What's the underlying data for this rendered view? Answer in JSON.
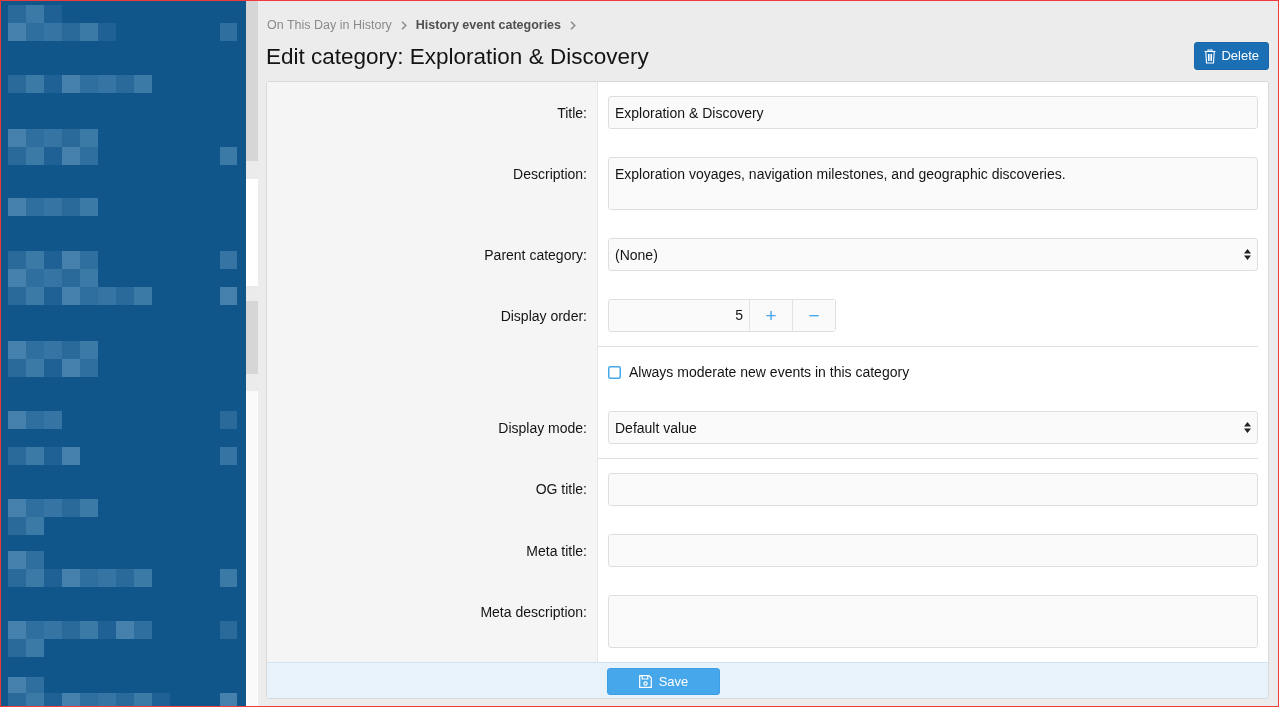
{
  "breadcrumb": [
    {
      "label": "On This Day in History",
      "current": false
    },
    {
      "label": "History event categories",
      "current": true
    }
  ],
  "title": "Edit category: Exploration & Discovery",
  "delete_button": {
    "label": "Delete"
  },
  "form": {
    "fields": [
      {
        "kind": "text",
        "label": "Title:",
        "value": "Exploration & Discovery",
        "separated": false
      },
      {
        "kind": "textarea",
        "label": "Description:",
        "value": "Exploration voyages, navigation milestones, and geographic discoveries.",
        "separated": false
      },
      {
        "kind": "select",
        "label": "Parent category:",
        "value": "(None)",
        "separated": false
      },
      {
        "kind": "number",
        "label": "Display order:",
        "value": "5",
        "buttons": [
          "+",
          "−"
        ],
        "separated": false
      },
      {
        "kind": "checkbox",
        "label": "Always moderate new events in this category",
        "checked": false,
        "separated": true
      },
      {
        "kind": "select",
        "label": "Display mode:",
        "value": "Default value",
        "separated": false
      },
      {
        "kind": "text",
        "label": "OG title:",
        "separated": true
      },
      {
        "kind": "text",
        "label": "Meta title:",
        "separated": false
      },
      {
        "kind": "textarea",
        "label": "Meta description:",
        "separated": false
      }
    ]
  },
  "save_button": {
    "label": "Save"
  }
}
